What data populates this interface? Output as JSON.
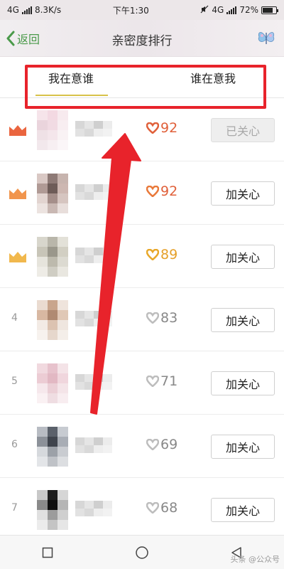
{
  "status_bar": {
    "network": "4G",
    "speed": "8.3K/s",
    "time": "下午1:30",
    "network_right": "4G",
    "battery": "72%"
  },
  "header": {
    "back_label": "返回",
    "title": "亲密度排行"
  },
  "tabs": [
    {
      "label": "我在意谁",
      "active": true
    },
    {
      "label": "谁在意我",
      "active": false
    }
  ],
  "rows": [
    {
      "rank": "",
      "crown_color": "#e8542a",
      "score": "92",
      "score_color": "#e0603a",
      "heart_color": "#e0603a",
      "button": "已关心",
      "followed": true
    },
    {
      "rank": "",
      "crown_color": "#f08a3a",
      "score": "92",
      "score_color": "#e0603a",
      "heart_color": "#e9793a",
      "button": "加关心",
      "followed": false
    },
    {
      "rank": "",
      "crown_color": "#f0b03a",
      "score": "89",
      "score_color": "#e5a02a",
      "heart_color": "#e8a82a",
      "button": "加关心",
      "followed": false
    },
    {
      "rank": "4",
      "crown_color": "",
      "score": "83",
      "score_color": "#888888",
      "heart_color": "#bdbdbd",
      "button": "加关心",
      "followed": false
    },
    {
      "rank": "5",
      "crown_color": "",
      "score": "71",
      "score_color": "#888888",
      "heart_color": "#bdbdbd",
      "button": "加关心",
      "followed": false
    },
    {
      "rank": "6",
      "crown_color": "",
      "score": "69",
      "score_color": "#888888",
      "heart_color": "#bdbdbd",
      "button": "加关心",
      "followed": false
    },
    {
      "rank": "7",
      "crown_color": "",
      "score": "68",
      "score_color": "#888888",
      "heart_color": "#bdbdbd",
      "button": "加关心",
      "followed": false
    }
  ],
  "avatar_palettes": [
    [
      "#f6e4ea",
      "#f3d9e2",
      "#f7eaee",
      "#ead4dc",
      "#f1dbe3",
      "#f8eef1",
      "#efe1e6",
      "#f4e6eb",
      "#f9f2f4",
      "#f2e8ec",
      "#f7eff2",
      "#fbf6f8"
    ],
    [
      "#d9c8c4",
      "#8e7a76",
      "#c7b4ae",
      "#b09a95",
      "#6e5c58",
      "#cdb7b1",
      "#e2d4d0",
      "#a58f8a",
      "#d6c5c0",
      "#ece3e0",
      "#c9b8b3",
      "#e8dedb"
    ],
    [
      "#d8d6cc",
      "#b9b6aa",
      "#e3e1d8",
      "#c8c5b8",
      "#9a978b",
      "#d2cfc3",
      "#e6e4dc",
      "#bdbaad",
      "#dcdad1",
      "#eeece6",
      "#cfcdc3",
      "#e9e7e0"
    ],
    [
      "#eadbd0",
      "#c9a58c",
      "#efe4dc",
      "#d8b8a2",
      "#b08a72",
      "#e0c8b6",
      "#f3ebe5",
      "#dcc3b1",
      "#efe6df",
      "#f7f2ee",
      "#e6d7cc",
      "#f4eee9"
    ],
    [
      "#f1d9df",
      "#e7c2cc",
      "#f4e3e7",
      "#ecccd4",
      "#e2b8c3",
      "#f0d6dd",
      "#f6e8ec",
      "#ebcfd6",
      "#f4e4e8",
      "#faf1f3",
      "#efdde2",
      "#f8edf0"
    ],
    [
      "#b8bcc3",
      "#5b616b",
      "#c7cbd1",
      "#8c9199",
      "#3f444d",
      "#a8adb5",
      "#d6d9dd",
      "#9ca1a8",
      "#c9ccd1",
      "#e3e5e8",
      "#bfc2c7",
      "#dcdee1"
    ],
    [
      "#c8c8c8",
      "#1e1e1e",
      "#d6d6d6",
      "#8a8a8a",
      "#0e0e0e",
      "#b5b5b5",
      "#e0e0e0",
      "#9c9c9c",
      "#cfcfcf",
      "#ececec",
      "#c4c4c4",
      "#e6e6e6"
    ]
  ],
  "name_palettes": [
    [
      "#d7d7d7",
      "#e5e5e5",
      "#cfcfcf",
      "#ececec",
      "#e2e2e2",
      "#d9d9d9",
      "#eeeeee",
      "#f2f2f2"
    ]
  ],
  "nav": {
    "watermark": "头条 @公众号"
  }
}
